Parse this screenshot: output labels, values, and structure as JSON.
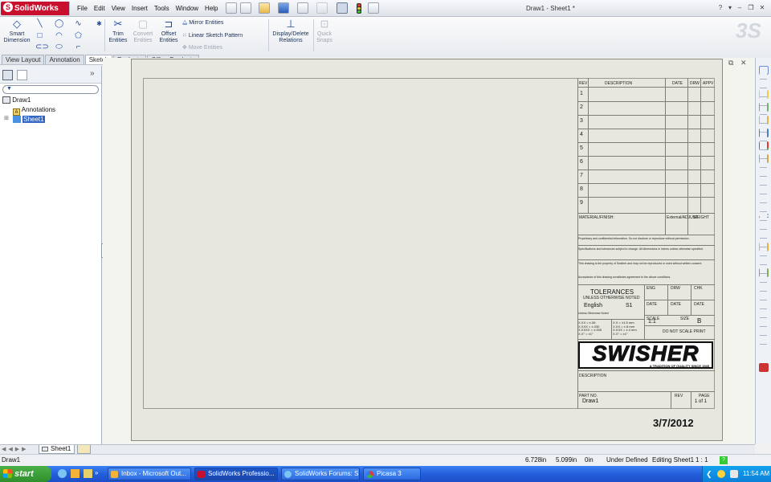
{
  "window": {
    "app_name": "SolidWorks",
    "doc_title": "Draw1 - Sheet1 *",
    "help_label": "?"
  },
  "menu": [
    "File",
    "Edit",
    "View",
    "Insert",
    "Tools",
    "Window",
    "Help"
  ],
  "commands": {
    "smart_dimension": [
      "Smart",
      "Dimension"
    ],
    "trim_entities": [
      "Trim",
      "Entities"
    ],
    "convert_entities": [
      "Convert",
      "Entities"
    ],
    "offset_entities": [
      "Offset",
      "Entities"
    ],
    "mirror_entities": "Mirror Entities",
    "linear_sketch_pattern": "Linear Sketch Pattern",
    "move_entities": "Move Entities",
    "display_delete_relations": [
      "Display/Delete",
      "Relations"
    ],
    "quick_snaps": [
      "Quick",
      "Snaps"
    ]
  },
  "tabs": [
    {
      "label": "View Layout",
      "active": false
    },
    {
      "label": "Annotation",
      "active": false
    },
    {
      "label": "Sketch",
      "active": true
    },
    {
      "label": "Evaluate",
      "active": false
    },
    {
      "label": "Office Products",
      "active": false
    }
  ],
  "tree": {
    "root": "Draw1",
    "items": [
      "Annotations",
      "Sheet1"
    ]
  },
  "sheet_tab": "Sheet1",
  "title_block": {
    "rev_headers": [
      "REV",
      "DESCRIPTION",
      "DATE",
      "DRW",
      "APPV"
    ],
    "rev_rows": [
      "1",
      "2",
      "3",
      "4",
      "5",
      "6",
      "7",
      "8",
      "9"
    ],
    "material": "MATERIAL/FINISH:",
    "material_note": "External/ADJUST",
    "weight": "WEIGHT",
    "note1": "Proprietary and confidential information. Do not disclose or reproduce without permission.",
    "note2": "Specifications and tolerances subject to change. All dimensions in inches unless otherwise specified.",
    "note3": "This drawing is the property of Swisher and may not be reproduced or used without written consent.",
    "note4": "Acceptance of this drawing constitutes agreement to the above conditions.",
    "tol_title": "TOLERANCES",
    "tol_sub": "UNLESS OTHERWISE NOTED",
    "units": "English",
    "units_note": "Unless Otherwise Noted",
    "tol_value": "S1",
    "tol_lines_left": [
      "X.XX = ±.06",
      "X.XXX = ±.030",
      "X.XXXX = ±.005",
      "X.X° = ±1°"
    ],
    "tol_lines_right": [
      "X.X = ±1.5 mm",
      "X.XX = ±.8 mm",
      "X.XXX = ±.4 mm",
      "X.X° = ±1°"
    ],
    "eng_labels": [
      "ENG",
      "DRW",
      "CHK"
    ],
    "date_labels": [
      "DATE",
      "DATE",
      "DATE"
    ],
    "scale_label": "SCALE",
    "scale_value": "1:1",
    "size_label": "SIZE",
    "size_value": "B",
    "do_not_scale": "DO NOT SCALE PRINT",
    "company": "SWISHER",
    "tagline": "A TRADITION OF QUALITY SINCE 1945",
    "description_label": "DESCRIPTION",
    "part_no_label": "PART NO.",
    "part_no": "Draw1",
    "rev_label": "REV",
    "page_label": "PAGE",
    "page_value": "1 of 1",
    "date": "3/7/2012"
  },
  "status": {
    "left": "Draw1",
    "x": "6.728in",
    "y": "5.099in",
    "z": "0in",
    "state": "Under Defined",
    "editing": "Editing Sheet1",
    "scale": "1 : 1",
    "help": "?"
  },
  "taskbar": {
    "start": "start",
    "items": [
      "Inbox - Microsoft Out...",
      "SolidWorks Professio...",
      "SolidWorks Forums: S...",
      "Picasa 3"
    ],
    "clock": "11:54 AM"
  }
}
